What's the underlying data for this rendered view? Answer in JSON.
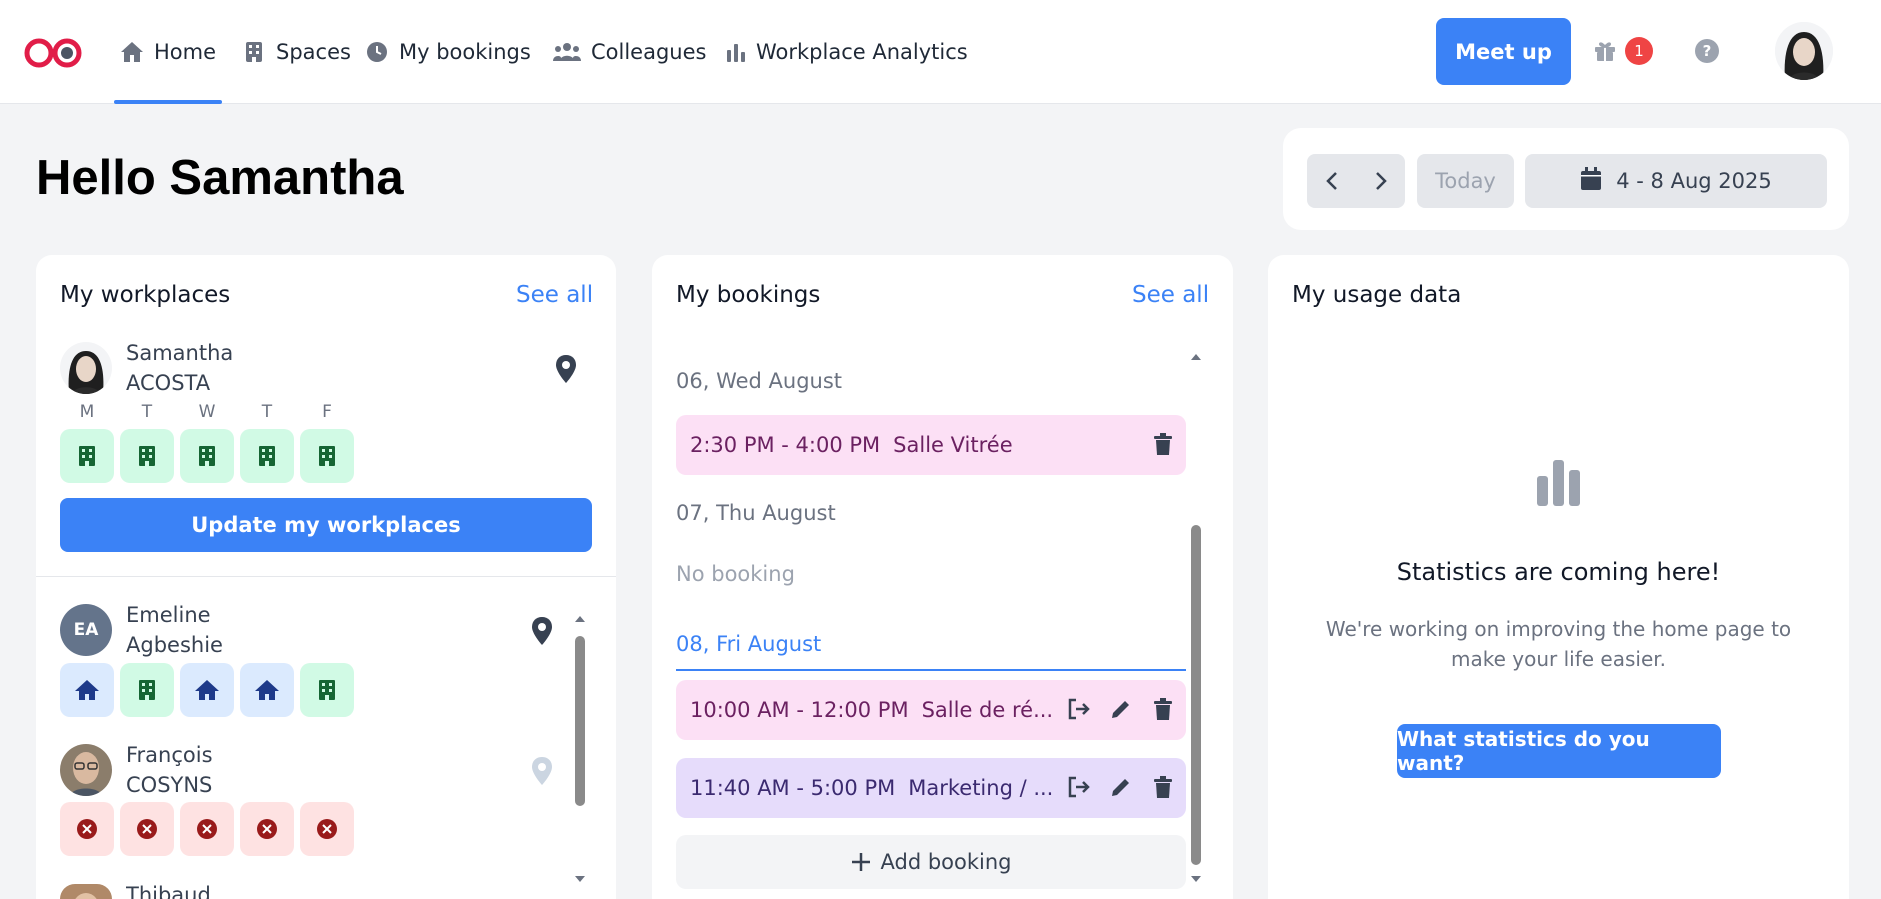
{
  "nav": {
    "items": [
      {
        "label": "Home",
        "icon": "home-icon"
      },
      {
        "label": "Spaces",
        "icon": "building-icon"
      },
      {
        "label": "My bookings",
        "icon": "clock-icon"
      },
      {
        "label": "Colleagues",
        "icon": "users-icon"
      },
      {
        "label": "Workplace Analytics",
        "icon": "bar-chart-icon"
      }
    ],
    "active": "Home",
    "meetup_label": "Meet up",
    "gift_badge": "1",
    "help_label": "?"
  },
  "greeting": "Hello Samantha",
  "date_nav": {
    "today_label": "Today",
    "range": "4 - 8 Aug 2025"
  },
  "workplaces": {
    "title": "My workplaces",
    "see_all": "See all",
    "days": [
      "M",
      "T",
      "W",
      "T",
      "F"
    ],
    "me": {
      "first": "Samantha",
      "last": "ACOSTA",
      "days": [
        "office",
        "office",
        "office",
        "office",
        "office"
      ]
    },
    "update_label": "Update my workplaces",
    "colleagues": [
      {
        "first": "Emeline",
        "last": "Agbeshie",
        "initials": "EA",
        "days": [
          "home",
          "office",
          "home",
          "home",
          "office"
        ]
      },
      {
        "first": "François",
        "last": "COSYNS",
        "days": [
          "absent",
          "absent",
          "absent",
          "absent",
          "absent"
        ]
      },
      {
        "first": "Thibaud",
        "last": ""
      }
    ]
  },
  "bookings": {
    "title": "My bookings",
    "see_all": "See all",
    "days": [
      {
        "label": "06, Wed August"
      },
      {
        "label": "07, Thu August",
        "empty": "No booking"
      },
      {
        "label": "08, Fri August"
      }
    ],
    "items": [
      {
        "time": "2:30 PM - 4:00 PM",
        "place": "Salle Vitrée"
      },
      {
        "time": "10:00 AM - 12:00 PM",
        "place": "Salle de ré..."
      },
      {
        "time": "11:40 AM - 5:00 PM",
        "place": "Marketing / ..."
      }
    ],
    "add_label": "Add booking"
  },
  "usage": {
    "title": "My usage data",
    "stat_title": "Statistics are coming here!",
    "stat_sub": "We're working on improving the home page to make your life easier.",
    "stat_button": "What statistics do you want?"
  },
  "colors": {
    "accent": "#3b82f6",
    "office_tile": "#d1fae5",
    "home_tile": "#dbeafe",
    "absent_tile": "#fee2e2",
    "booking_pink": "#fce0f5",
    "booking_purple": "#e6dcfb"
  }
}
